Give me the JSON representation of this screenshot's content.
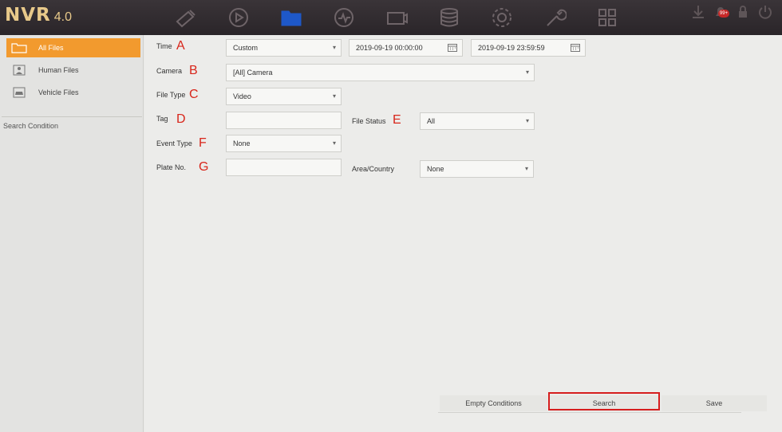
{
  "app": {
    "name": "NVR",
    "version": "4.0",
    "notification_count": "99+"
  },
  "nav": [
    {
      "name": "live-view-icon"
    },
    {
      "name": "playback-icon"
    },
    {
      "name": "file-management-icon",
      "active": true
    },
    {
      "name": "smart-analysis-icon"
    },
    {
      "name": "camera-icon"
    },
    {
      "name": "storage-icon"
    },
    {
      "name": "system-settings-icon"
    },
    {
      "name": "maintenance-icon"
    },
    {
      "name": "more-apps-icon"
    }
  ],
  "sidebar": {
    "items": [
      {
        "label": "All Files",
        "active": true
      },
      {
        "label": "Human Files"
      },
      {
        "label": "Vehicle Files"
      }
    ],
    "search_condition": "Search Condition"
  },
  "form": {
    "time": {
      "label": "Time",
      "marker": "A",
      "value": "Custom",
      "start": "2019-09-19 00:00:00",
      "end": "2019-09-19 23:59:59"
    },
    "camera": {
      "label": "Camera",
      "marker": "B",
      "value": "[All] Camera"
    },
    "file_type": {
      "label": "File Type",
      "marker": "C",
      "value": "Video"
    },
    "tag": {
      "label": "Tag",
      "marker": "D",
      "value": ""
    },
    "file_status": {
      "label": "File Status",
      "marker": "E",
      "value": "All"
    },
    "event_type": {
      "label": "Event Type",
      "marker": "F",
      "value": "None"
    },
    "plate_no": {
      "label": "Plate No.",
      "marker": "G",
      "value": ""
    },
    "area_country": {
      "label": "Area/Country",
      "value": "None"
    }
  },
  "buttons": {
    "empty": "Empty Conditions",
    "search": "Search",
    "save": "Save"
  },
  "colors": {
    "accent": "#f29a2e",
    "active_icon": "#1e58c8",
    "annotation": "#d8261b"
  }
}
